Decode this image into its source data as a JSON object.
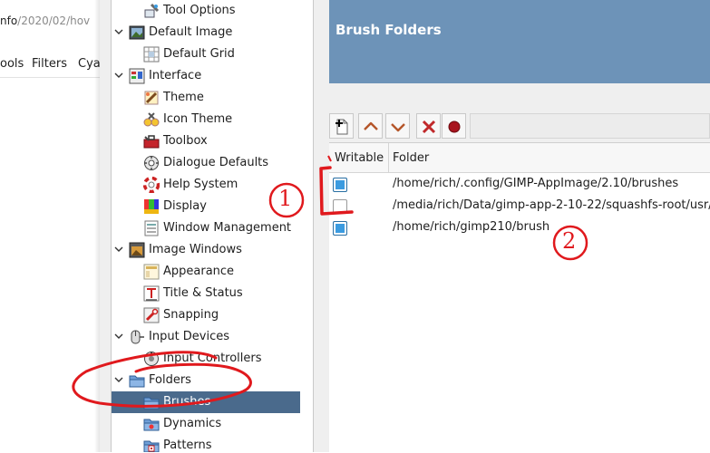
{
  "background_window": {
    "url_prefix": "nfo",
    "url_rest": "/2020/02/hov",
    "menu": [
      "ools",
      "Filters",
      "Cya"
    ]
  },
  "tree": {
    "items": [
      {
        "label": "Tool Options",
        "icon": "tool-options-icon",
        "indent": 1,
        "expander": ""
      },
      {
        "label": "Default Image",
        "icon": "default-image-icon",
        "indent": 0,
        "expander": "v"
      },
      {
        "label": "Default Grid",
        "icon": "default-grid-icon",
        "indent": 1,
        "expander": ""
      },
      {
        "label": "Interface",
        "icon": "interface-icon",
        "indent": 0,
        "expander": "v"
      },
      {
        "label": "Theme",
        "icon": "theme-icon",
        "indent": 1,
        "expander": ""
      },
      {
        "label": "Icon Theme",
        "icon": "icon-theme-icon",
        "indent": 1,
        "expander": ""
      },
      {
        "label": "Toolbox",
        "icon": "toolbox-icon",
        "indent": 1,
        "expander": ""
      },
      {
        "label": "Dialogue Defaults",
        "icon": "dialogue-defaults-icon",
        "indent": 1,
        "expander": ""
      },
      {
        "label": "Help System",
        "icon": "help-system-icon",
        "indent": 1,
        "expander": ""
      },
      {
        "label": "Display",
        "icon": "display-icon",
        "indent": 1,
        "expander": ""
      },
      {
        "label": "Window Management",
        "icon": "window-management-icon",
        "indent": 1,
        "expander": ""
      },
      {
        "label": "Image Windows",
        "icon": "image-windows-icon",
        "indent": 0,
        "expander": "v"
      },
      {
        "label": "Appearance",
        "icon": "appearance-icon",
        "indent": 1,
        "expander": ""
      },
      {
        "label": "Title & Status",
        "icon": "title-status-icon",
        "indent": 1,
        "expander": ""
      },
      {
        "label": "Snapping",
        "icon": "snapping-icon",
        "indent": 1,
        "expander": ""
      },
      {
        "label": "Input Devices",
        "icon": "input-devices-icon",
        "indent": 0,
        "expander": "v"
      },
      {
        "label": "Input Controllers",
        "icon": "input-controllers-icon",
        "indent": 1,
        "expander": ""
      },
      {
        "label": "Folders",
        "icon": "folders-icon",
        "indent": 0,
        "expander": "v"
      },
      {
        "label": "Brushes",
        "icon": "brushes-icon",
        "indent": 1,
        "expander": "",
        "selected": true
      },
      {
        "label": "Dynamics",
        "icon": "dynamics-icon",
        "indent": 1,
        "expander": ""
      },
      {
        "label": "Patterns",
        "icon": "patterns-icon",
        "indent": 1,
        "expander": ""
      }
    ]
  },
  "page": {
    "title": "Brush Folders"
  },
  "toolbar": {
    "buttons": [
      {
        "name": "add-folder-button",
        "icon": "add-folder-icon"
      },
      {
        "name": "move-up-button",
        "icon": "chevron-up-icon"
      },
      {
        "name": "move-down-button",
        "icon": "chevron-down-icon"
      },
      {
        "name": "delete-folder-button",
        "icon": "delete-icon"
      },
      {
        "name": "reset-button",
        "icon": "record-icon"
      }
    ]
  },
  "table": {
    "columns": [
      "Writable",
      "Folder"
    ],
    "rows": [
      {
        "writable": true,
        "folder": "/home/rich/.config/GIMP-AppImage/2.10/brushes"
      },
      {
        "writable": false,
        "folder": "/media/rich/Data/gimp-app-2-10-22/squashfs-root/usr/s"
      },
      {
        "writable": true,
        "folder": "/home/rich/gimp210/brush"
      }
    ]
  },
  "annotations": {
    "label_1": "1",
    "label_2": "2",
    "color": "#e0191d"
  },
  "colors": {
    "header_banner": "#6d93b8",
    "selection": "#4a6a8c",
    "checkbox_on": "#3b9be0"
  }
}
